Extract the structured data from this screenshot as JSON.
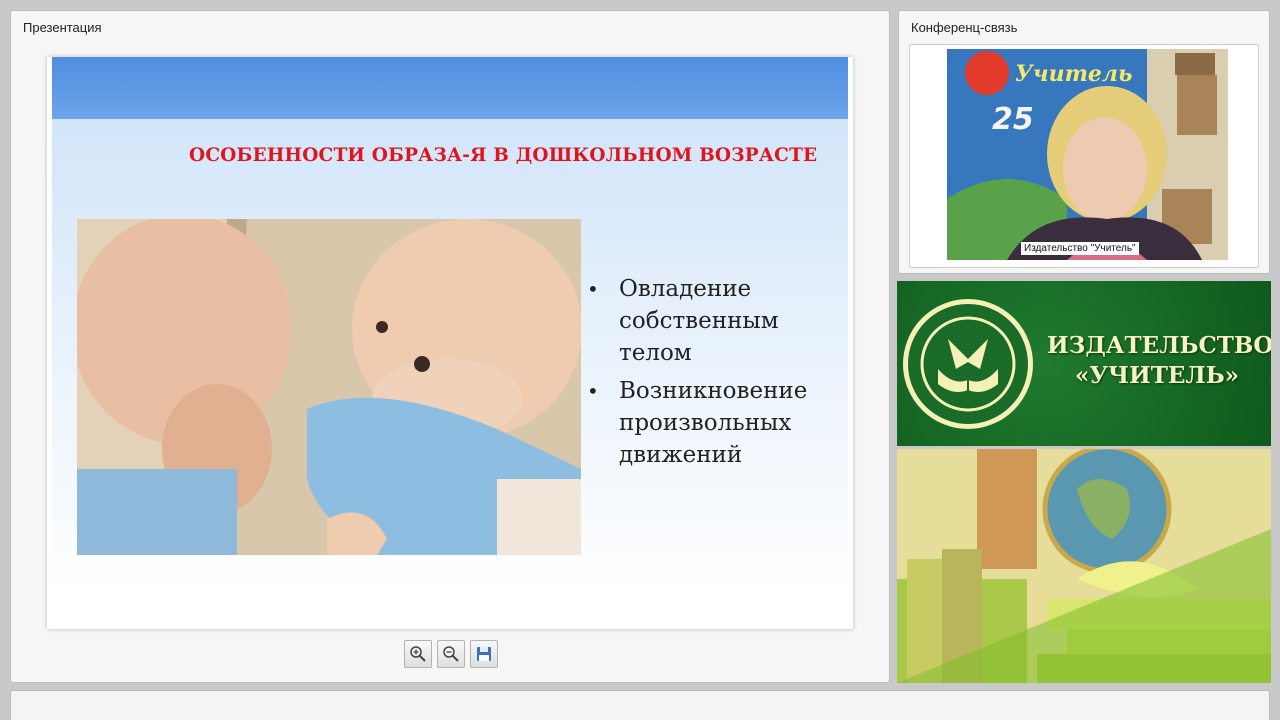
{
  "presentation": {
    "title": "Презентация",
    "slide": {
      "title": "ОСОБЕННОСТИ ОБРАЗА-Я В ДОШКОЛЬНОМ ВОЗРАСТЕ",
      "bullets": [
        "Овладение собственным телом",
        "Возникновение произвольных движений"
      ]
    },
    "toolbar": {
      "zoom_in_icon": "zoom-in-icon",
      "zoom_out_icon": "zoom-out-icon",
      "save_icon": "save-icon"
    }
  },
  "conference": {
    "title": "Конференц-связь",
    "video_caption": "Издательство \"Учитель\""
  },
  "ad": {
    "line1": "ИЗДАТЕЛЬСТВО",
    "line2": "«УЧИТЕЛЬ»",
    "colors": {
      "green": "#1a6b27",
      "cream": "#f4f0b6"
    }
  }
}
